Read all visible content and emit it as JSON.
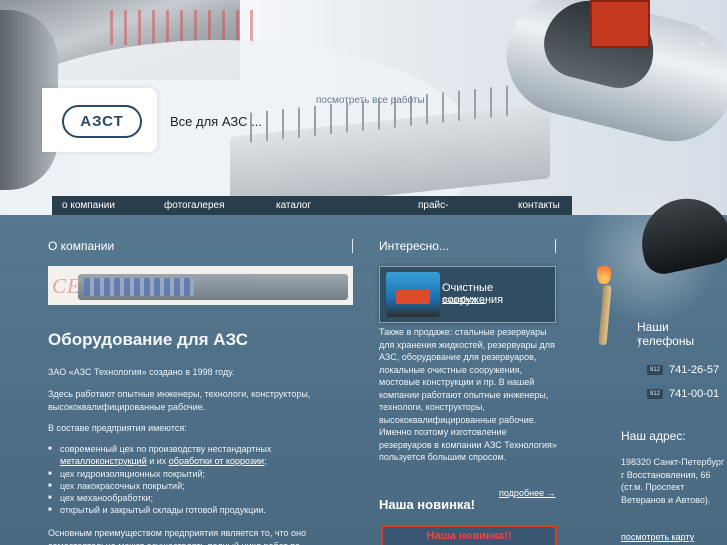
{
  "header": {
    "logo_text": "АЗСТ",
    "slogan": "Все для АЗС ...",
    "all_works_link": "посмотреть все работы",
    "icons": [
      "home-icon",
      "mail-icon",
      "sitemap-icon"
    ]
  },
  "nav": {
    "items": [
      {
        "label": "о компании"
      },
      {
        "label": "фотогалерея"
      },
      {
        "label": "каталог продукции"
      },
      {
        "label": "прайс-лист"
      },
      {
        "label": "контакты"
      }
    ]
  },
  "left": {
    "section_title": "О компании",
    "banner_text": "СЕ",
    "heading": "Оборудование для АЗС",
    "p1": "ЗАО «АЗС Технология» создано в 1998 году.",
    "p2": "Здесь работают опытные инженеры, технологи, конструкторы, высококвалифицированные рабочие.",
    "p3": "В составе предприятия имеются:",
    "bullets": {
      "b1_text": "современный цех по производству нестандартных",
      "b1_link1": "металлоконструкций",
      "b1_mid": " и их ",
      "b1_link2": "обработки от коррозии",
      "b1_end": ";",
      "b2": "цех гидроизоляционных покрытий;",
      "b3": "цех лакокрасочных покрытий;",
      "b4": "цех механообработки;",
      "b5": "открытый и закрытый склады готовой продукции."
    },
    "p4": "Основным преимуществом предприятия является то, что оно самостоятельно может осуществлять полный цикл работ по"
  },
  "right": {
    "section_title": "Интересно...",
    "promo_title": "Очистные сооружения",
    "promo_more": "подробнее →",
    "also_text": "Также в продаже: стальные резервуары для хранения жидкостей, резервуары для АЗС, оборудование для резервуаров, локальные очистные сооружения, мостовые конструкции и пр. В нашей компании работают опытные инженеры, технологи, конструкторы, высококвалифицированные рабочие. Именно поэтому изготовление резервуаров в компании   АЗС Технология» пользуется большим спросом.",
    "more_link": "подробнее →",
    "novelty_title": "Наша новинка!",
    "novelty_banner": "Наша новинка!!"
  },
  "contacts": {
    "phones_title": "Наши телефоны",
    "phones_colon": ":",
    "phones": [
      {
        "code": "812",
        "number": "741-26-57"
      },
      {
        "code": "812",
        "number": "741-00-01"
      }
    ],
    "address_title": "Наш адрес:",
    "address": "198320 Санкт-Петербург г Восстановления, 66 (ст.м. Проспект Ветеранов и Автово).",
    "map_link": "посмотреть карту"
  }
}
